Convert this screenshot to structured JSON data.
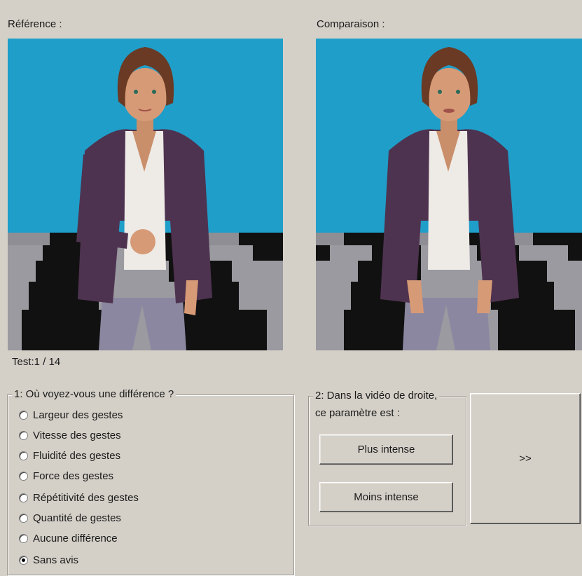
{
  "labels": {
    "reference": "Référence :",
    "comparison": "Comparaison :",
    "test_counter": "Test:1 / 14"
  },
  "question1": {
    "legend": "1: Où voyez-vous une différence ?",
    "options": [
      "Largeur des gestes",
      "Vitesse des gestes",
      "Fluidité des gestes",
      "Force des gestes",
      "Répétitivité des gestes",
      "Quantité de gestes",
      "Aucune différence",
      "Sans avis"
    ],
    "selected_index": 7
  },
  "question2": {
    "legend_line1": "2: Dans la vidéo de droite,",
    "legend_line2": "ce paramètre est :",
    "more_label": "Plus intense",
    "less_label": "Moins intense"
  },
  "next_button_label": ">>",
  "colors": {
    "window_bg": "#d4d0c8",
    "video_sky": "#1f9ec9",
    "jacket": "#4e3350",
    "pants": "#8c87a0",
    "hair": "#6a3a24"
  },
  "icons": {
    "avatar_left": "woman-avatar-fist",
    "avatar_right": "woman-avatar-hands-open"
  }
}
